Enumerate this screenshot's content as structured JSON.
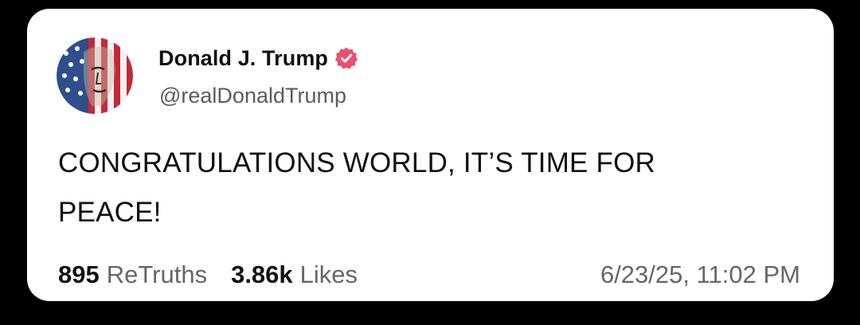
{
  "post": {
    "author": {
      "display_name": "Donald J. Trump",
      "handle": "@realDonaldTrump",
      "verified": true,
      "verified_color": "#ec4f6d"
    },
    "text_lines": [
      "CONGRATULATIONS WORLD, IT’S TIME FOR",
      "PEACE!"
    ],
    "stats": {
      "retruths_count": "895",
      "retruths_label": "ReTruths",
      "likes_count": "3.86k",
      "likes_label": "Likes"
    },
    "timestamp": "6/23/25, 11:02 PM"
  }
}
